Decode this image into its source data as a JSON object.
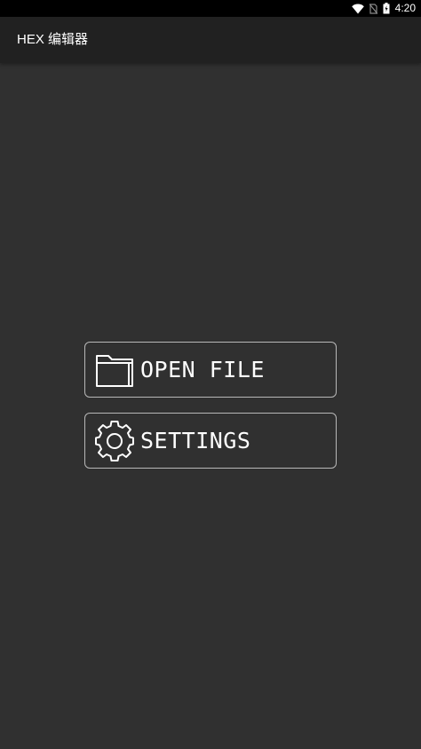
{
  "status_bar": {
    "time": "4:20",
    "icons": [
      "wifi-icon",
      "no-sim-icon",
      "battery-charging-icon"
    ]
  },
  "app_bar": {
    "title": "HEX 编辑器"
  },
  "menu": {
    "open_file": {
      "label": "OPEN FILE",
      "icon": "folder-icon"
    },
    "settings": {
      "label": "SETTINGS",
      "icon": "gear-icon"
    }
  },
  "colors": {
    "background": "#303030",
    "app_bar": "#212121",
    "status_bar": "#000000",
    "button_border": "#b8b8b8",
    "text": "#ffffff"
  }
}
